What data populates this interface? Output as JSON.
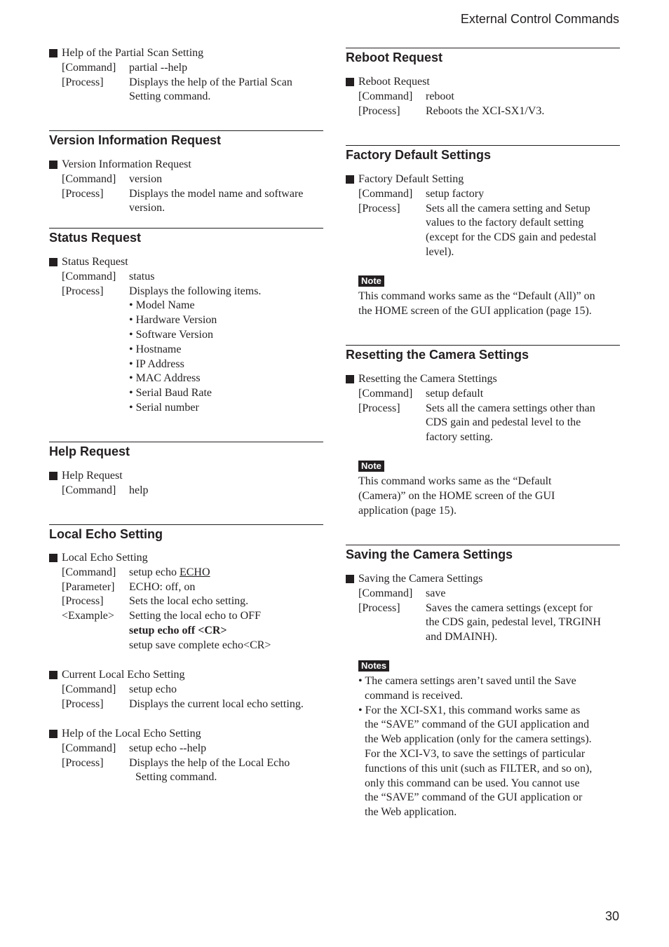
{
  "header": {
    "title": "External Control Commands"
  },
  "page_number": "30",
  "left": [
    {
      "type": "item",
      "title": "Help of the Partial Scan Setting",
      "rows": [
        {
          "label": "[Command]",
          "value": [
            "partial --help"
          ]
        },
        {
          "label": "[Process]",
          "value": [
            "Displays the help of the Partial Scan",
            "Setting command."
          ]
        }
      ]
    },
    {
      "type": "heading",
      "text": "Version  Information Request"
    },
    {
      "type": "item",
      "title": "Version Information Request",
      "rows": [
        {
          "label": "[Command]",
          "value": [
            "version"
          ]
        },
        {
          "label": "[Process]",
          "value": [
            "Displays the model name and software",
            "version."
          ]
        }
      ]
    },
    {
      "type": "heading",
      "text": "Status Request"
    },
    {
      "type": "item",
      "title": "Status  Request",
      "rows": [
        {
          "label": "[Command]",
          "value": [
            "status"
          ]
        },
        {
          "label": "[Process]",
          "value": [
            "Displays the following items.",
            "• Model Name",
            "• Hardware Version",
            "• Software Version",
            "• Hostname",
            "• IP Address",
            "• MAC Address",
            "• Serial Baud Rate",
            "• Serial number"
          ]
        }
      ]
    },
    {
      "type": "heading",
      "text": "Help  Request"
    },
    {
      "type": "item",
      "title": "Help  Request",
      "rows": [
        {
          "label": "[Command]",
          "value": [
            "help"
          ]
        }
      ]
    },
    {
      "type": "heading",
      "text": "Local Echo Setting"
    },
    {
      "type": "item",
      "title": "Local Echo Setting",
      "rows": [
        {
          "label": "[Command]",
          "value": [
            {
              "t": "setup echo ",
              "u": "ECHO"
            }
          ]
        },
        {
          "label": "[Parameter]",
          "value": [
            "ECHO: off, on"
          ]
        },
        {
          "label": "[Process]",
          "value": [
            "Sets the local echo setting."
          ]
        },
        {
          "label": "<Example>",
          "value": [
            "Setting the local echo to OFF",
            {
              "b": "setup echo off <CR>"
            },
            "setup save complete echo<CR>"
          ]
        }
      ]
    },
    {
      "type": "item",
      "title": "Current Local Echo Setting",
      "rows": [
        {
          "label": "[Command]",
          "value": [
            "setup echo"
          ]
        },
        {
          "label": "[Process]",
          "value": [
            "Displays the current local echo setting."
          ]
        }
      ]
    },
    {
      "type": "item",
      "title": "Help of the Local Echo Setting",
      "rows": [
        {
          "label": "[Command]",
          "value": [
            "setup echo --help"
          ]
        },
        {
          "label": "[Process]",
          "value": [
            "Displays the help of the Local Echo",
            {
              "i": "Setting command."
            }
          ]
        }
      ]
    }
  ],
  "right": [
    {
      "type": "heading",
      "text": "Reboot Request"
    },
    {
      "type": "item",
      "title": "Reboot Request",
      "rows": [
        {
          "label": "[Command]",
          "value": [
            "reboot"
          ]
        },
        {
          "label": "[Process]",
          "value": [
            "Reboots the XCI-SX1/V3."
          ]
        }
      ]
    },
    {
      "type": "heading",
      "text": "Factory Default Settings"
    },
    {
      "type": "item",
      "title": "Factory Default Setting",
      "rows": [
        {
          "label": "[Command]",
          "value": [
            "setup factory"
          ]
        },
        {
          "label": "[Process]",
          "value": [
            "Sets all the camera setting and Setup",
            "values to the factory default setting",
            "(except for the CDS gain and pedestal",
            "level)."
          ]
        }
      ]
    },
    {
      "type": "note",
      "badge": "Note",
      "lines": [
        "This command works same as the “Default (All)” on",
        "the HOME screen of the GUI application (page 15)."
      ]
    },
    {
      "type": "heading",
      "text": "Resetting the Camera Settings"
    },
    {
      "type": "item",
      "title": "Resetting the Camera Stettings",
      "rows": [
        {
          "label": "[Command]",
          "value": [
            "setup default"
          ]
        },
        {
          "label": "[Process]",
          "value": [
            "Sets all the camera settings other than",
            "CDS gain and pedestal level to the",
            "factory setting."
          ]
        }
      ]
    },
    {
      "type": "note",
      "badge": "Note",
      "lines": [
        "This command works same as the “Default",
        "(Camera)” on the HOME screen of the GUI",
        "application (page 15)."
      ]
    },
    {
      "type": "heading",
      "text": "Saving the Camera Settings"
    },
    {
      "type": "item",
      "title": "Saving the Camera Settings",
      "rows": [
        {
          "label": "[Command]",
          "value": [
            "save"
          ]
        },
        {
          "label": "[Process]",
          "value": [
            "Saves the camera settings (except for",
            "the CDS gain, pedestal level, TRGINH",
            "and DMAINH)."
          ]
        }
      ]
    },
    {
      "type": "notes",
      "badge": "Notes",
      "bullets": [
        [
          "• The camera settings aren’t saved until the Save",
          "command is received."
        ],
        [
          "• For the XCI-SX1, this command works same as",
          "the “SAVE” command of the GUI application and",
          "the Web application (only for the camera settings).",
          "For the XCI-V3, to save the settings of particular",
          "functions of this unit (such as FILTER, and so on),",
          "only this command can be used. You cannot use",
          "the “SAVE” command of the GUI application or",
          "the Web application."
        ]
      ]
    }
  ]
}
